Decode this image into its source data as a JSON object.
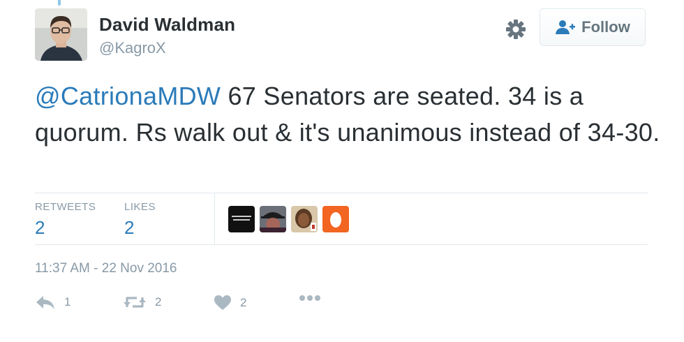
{
  "user": {
    "display_name": "David Waldman",
    "handle": "@KagroX"
  },
  "header": {
    "gear_icon": "gear-icon",
    "follow_label": "Follow",
    "follow_icon": "person-add-icon"
  },
  "tweet": {
    "mention": "@CatrionaMDW",
    "text": " 67 Senators are seated. 34 is a quorum. Rs walk out & it's unanimous instead of 34-30."
  },
  "stats": {
    "retweets_label": "RETWEETS",
    "retweets_count": "2",
    "likes_label": "LIKES",
    "likes_count": "2"
  },
  "timestamp": "11:37 AM - 22 Nov 2016",
  "actions": {
    "reply_count": "1",
    "retweet_count": "2",
    "like_count": "2"
  },
  "colors": {
    "link": "#2b7bb9",
    "muted": "#8899a6",
    "text": "#292f33",
    "border": "#e1e8ed"
  }
}
